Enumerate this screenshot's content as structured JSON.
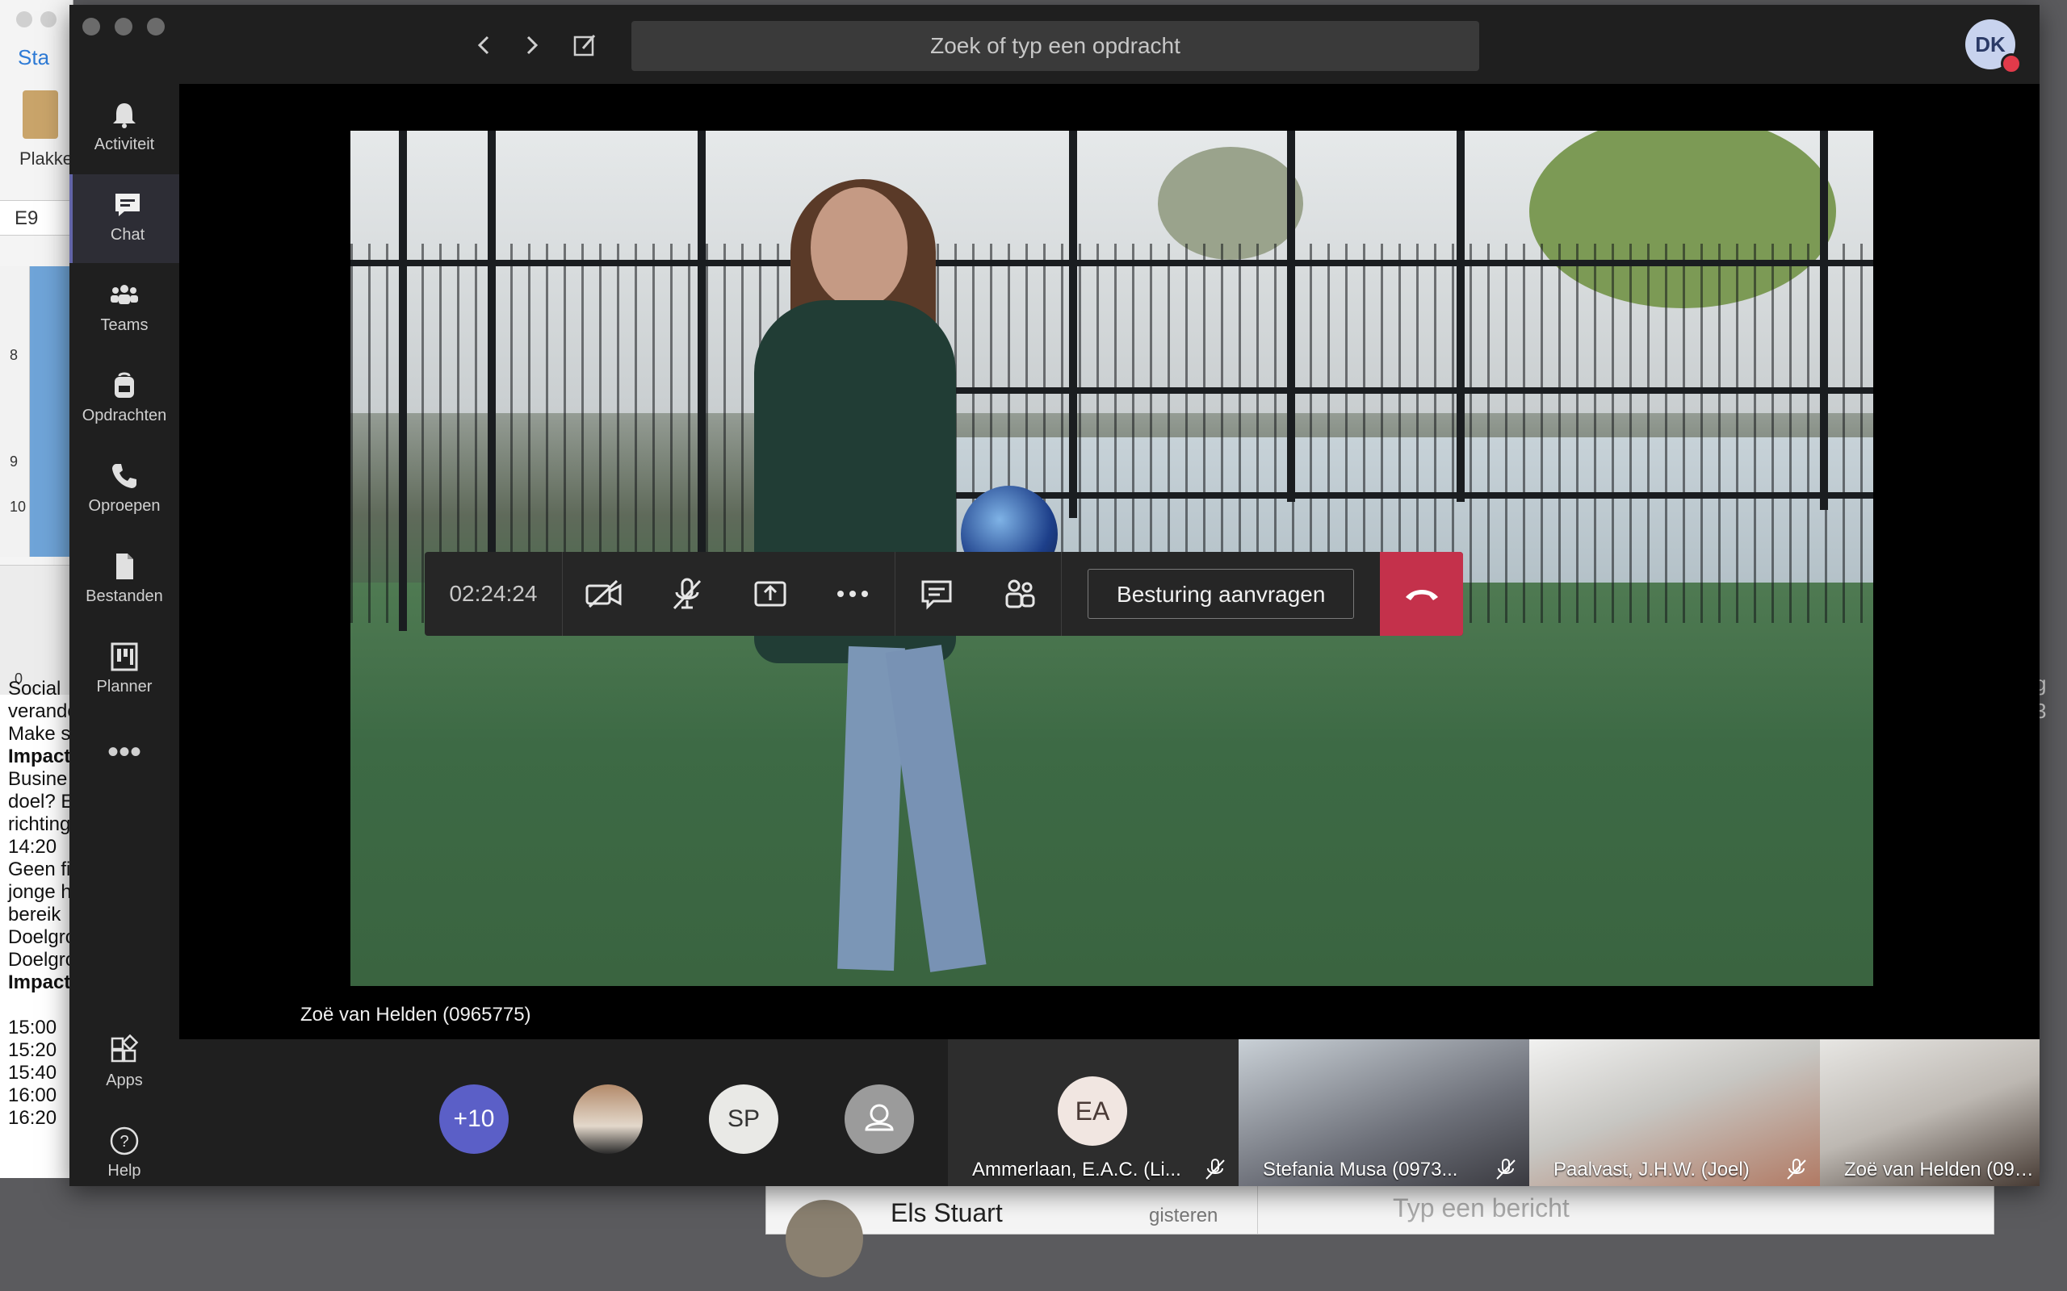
{
  "background": {
    "excel": {
      "tab_start": "Sta",
      "paste_label": "Plakke",
      "cell_ref": "E9",
      "row_numbers": [
        "8",
        "9",
        "10"
      ],
      "ruler_zero": "0",
      "doc_lines": [
        "Social",
        "verande",
        "Make s",
        "Impact",
        "Busine",
        "doel? E",
        "richting",
        "14:20",
        "Geen fi",
        "jonge h",
        "bereik",
        "Doelgro",
        "Doelgro",
        "Impact",
        "",
        "15:00",
        "15:20",
        "15:40",
        "16:00",
        "16:20"
      ]
    },
    "chat_preview": {
      "name": "Els Stuart",
      "when": "gisteren",
      "placeholder": "Typ een bericht"
    },
    "right_edge": [
      "g",
      "3"
    ]
  },
  "titlebar": {
    "search_placeholder": "Zoek of typ een opdracht",
    "avatar_initials": "DK"
  },
  "rail": [
    {
      "key": "activiteit",
      "label": "Activiteit",
      "icon": "bell-icon",
      "active": false
    },
    {
      "key": "chat",
      "label": "Chat",
      "icon": "chat-icon",
      "active": true
    },
    {
      "key": "teams",
      "label": "Teams",
      "icon": "teams-icon",
      "active": false
    },
    {
      "key": "opdrachten",
      "label": "Opdrachten",
      "icon": "backpack-icon",
      "active": false
    },
    {
      "key": "oproepen",
      "label": "Oproepen",
      "icon": "phone-icon",
      "active": false
    },
    {
      "key": "bestanden",
      "label": "Bestanden",
      "icon": "file-icon",
      "active": false
    },
    {
      "key": "planner",
      "label": "Planner",
      "icon": "planner-icon",
      "active": false
    }
  ],
  "rail_bottom": {
    "apps_label": "Apps",
    "help_label": "Help"
  },
  "call": {
    "timer": "02:24:24",
    "request_control": "Besturing aanvragen",
    "speaker_name": "Zoë van Helden (0965775)"
  },
  "roster": {
    "overflow_count": "+10",
    "sp_initials": "SP",
    "ea_initials": "EA",
    "tiles": [
      {
        "name": "Ammerlaan, E.A.C. (Li..."
      },
      {
        "name": "Stefania Musa (0973..."
      },
      {
        "name": "Paalvast, J.H.W. (Joel)"
      },
      {
        "name": "Zoë van Helden (0965775)"
      }
    ]
  },
  "colors": {
    "accent": "#6264a7",
    "hangup": "#c4314b",
    "overflow_badge": "#5b5fc7",
    "status_busy": "#e23a4a"
  }
}
